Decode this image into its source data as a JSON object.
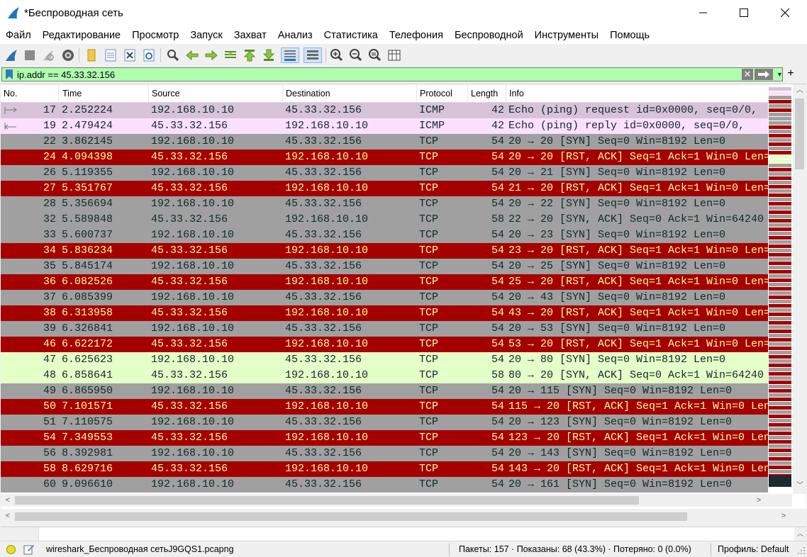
{
  "window": {
    "title": "*Беспроводная сеть"
  },
  "menu": [
    "Файл",
    "Редактирование",
    "Просмотр",
    "Запуск",
    "Захват",
    "Анализ",
    "Статистика",
    "Телефония",
    "Беспроводной",
    "Инструменты",
    "Помощь"
  ],
  "toolbar": {
    "icons": [
      "shark-fin-start-icon",
      "stop-capture-icon",
      "restart-capture-icon",
      "capture-options-icon",
      "open-file-icon",
      "save-file-icon",
      "close-file-icon",
      "reload-file-icon",
      "find-packet-icon",
      "go-back-icon",
      "go-forward-icon",
      "go-to-packet-icon",
      "go-first-icon",
      "go-last-icon",
      "autoscroll-icon",
      "colorize-icon",
      "zoom-in-icon",
      "zoom-out-icon",
      "zoom-normal-icon",
      "resize-columns-icon"
    ]
  },
  "filter": {
    "value": "ip.addr == 45.33.32.156",
    "background": "#afffaf"
  },
  "columns": [
    "No.",
    "Time",
    "Source",
    "Destination",
    "Protocol",
    "Length",
    "Info"
  ],
  "colors": {
    "icmp_request": "#d8c2da",
    "icmp_reply": "#fce0ff",
    "tcp_syn": "#a0a0a0",
    "tcp_rst": "#a40000",
    "tcp_rst_text": "#fffc9c",
    "tcp_http": "#e4ffc7"
  },
  "packets": [
    {
      "no": "17",
      "time": "2.252224",
      "src": "192.168.10.10",
      "dst": "45.33.32.156",
      "proto": "ICMP",
      "len": "42",
      "info": "Echo (ping) request  id=0x0000, seq=0/0,",
      "style": "icmp_request"
    },
    {
      "no": "19",
      "time": "2.479424",
      "src": "45.33.32.156",
      "dst": "192.168.10.10",
      "proto": "ICMP",
      "len": "42",
      "info": "Echo (ping) reply    id=0x0000, seq=0/0,",
      "style": "icmp_reply"
    },
    {
      "no": "22",
      "time": "3.862145",
      "src": "192.168.10.10",
      "dst": "45.33.32.156",
      "proto": "TCP",
      "len": "54",
      "info": "20 → 20 [SYN] Seq=0 Win=8192 Len=0",
      "style": "tcp_syn"
    },
    {
      "no": "24",
      "time": "4.094398",
      "src": "45.33.32.156",
      "dst": "192.168.10.10",
      "proto": "TCP",
      "len": "54",
      "info": "20 → 20 [RST, ACK] Seq=1 Ack=1 Win=0 Len=",
      "style": "tcp_rst"
    },
    {
      "no": "26",
      "time": "5.119355",
      "src": "192.168.10.10",
      "dst": "45.33.32.156",
      "proto": "TCP",
      "len": "54",
      "info": "20 → 21 [SYN] Seq=0 Win=8192 Len=0",
      "style": "tcp_syn"
    },
    {
      "no": "27",
      "time": "5.351767",
      "src": "45.33.32.156",
      "dst": "192.168.10.10",
      "proto": "TCP",
      "len": "54",
      "info": "21 → 20 [RST, ACK] Seq=1 Ack=1 Win=0 Len=",
      "style": "tcp_rst"
    },
    {
      "no": "28",
      "time": "5.356694",
      "src": "192.168.10.10",
      "dst": "45.33.32.156",
      "proto": "TCP",
      "len": "54",
      "info": "20 → 22 [SYN] Seq=0 Win=8192 Len=0",
      "style": "tcp_syn"
    },
    {
      "no": "32",
      "time": "5.589848",
      "src": "45.33.32.156",
      "dst": "192.168.10.10",
      "proto": "TCP",
      "len": "58",
      "info": "22 → 20 [SYN, ACK] Seq=0 Ack=1 Win=64240",
      "style": "tcp_syn"
    },
    {
      "no": "33",
      "time": "5.600737",
      "src": "192.168.10.10",
      "dst": "45.33.32.156",
      "proto": "TCP",
      "len": "54",
      "info": "20 → 23 [SYN] Seq=0 Win=8192 Len=0",
      "style": "tcp_syn"
    },
    {
      "no": "34",
      "time": "5.836234",
      "src": "45.33.32.156",
      "dst": "192.168.10.10",
      "proto": "TCP",
      "len": "54",
      "info": "23 → 20 [RST, ACK] Seq=1 Ack=1 Win=0 Len=",
      "style": "tcp_rst"
    },
    {
      "no": "35",
      "time": "5.845174",
      "src": "192.168.10.10",
      "dst": "45.33.32.156",
      "proto": "TCP",
      "len": "54",
      "info": "20 → 25 [SYN] Seq=0 Win=8192 Len=0",
      "style": "tcp_syn"
    },
    {
      "no": "36",
      "time": "6.082526",
      "src": "45.33.32.156",
      "dst": "192.168.10.10",
      "proto": "TCP",
      "len": "54",
      "info": "25 → 20 [RST, ACK] Seq=1 Ack=1 Win=0 Len=",
      "style": "tcp_rst"
    },
    {
      "no": "37",
      "time": "6.085399",
      "src": "192.168.10.10",
      "dst": "45.33.32.156",
      "proto": "TCP",
      "len": "54",
      "info": "20 → 43 [SYN] Seq=0 Win=8192 Len=0",
      "style": "tcp_syn"
    },
    {
      "no": "38",
      "time": "6.313958",
      "src": "45.33.32.156",
      "dst": "192.168.10.10",
      "proto": "TCP",
      "len": "54",
      "info": "43 → 20 [RST, ACK] Seq=1 Ack=1 Win=0 Len=",
      "style": "tcp_rst"
    },
    {
      "no": "39",
      "time": "6.326841",
      "src": "192.168.10.10",
      "dst": "45.33.32.156",
      "proto": "TCP",
      "len": "54",
      "info": "20 → 53 [SYN] Seq=0 Win=8192 Len=0",
      "style": "tcp_syn"
    },
    {
      "no": "46",
      "time": "6.622172",
      "src": "45.33.32.156",
      "dst": "192.168.10.10",
      "proto": "TCP",
      "len": "54",
      "info": "53 → 20 [RST, ACK] Seq=1 Ack=1 Win=0 Len=",
      "style": "tcp_rst"
    },
    {
      "no": "47",
      "time": "6.625623",
      "src": "192.168.10.10",
      "dst": "45.33.32.156",
      "proto": "TCP",
      "len": "54",
      "info": "20 → 80 [SYN] Seq=0 Win=8192 Len=0",
      "style": "tcp_http"
    },
    {
      "no": "48",
      "time": "6.858641",
      "src": "45.33.32.156",
      "dst": "192.168.10.10",
      "proto": "TCP",
      "len": "58",
      "info": "80 → 20 [SYN, ACK] Seq=0 Ack=1 Win=64240",
      "style": "tcp_http"
    },
    {
      "no": "49",
      "time": "6.865950",
      "src": "192.168.10.10",
      "dst": "45.33.32.156",
      "proto": "TCP",
      "len": "54",
      "info": "20 → 115 [SYN] Seq=0 Win=8192 Len=0",
      "style": "tcp_syn"
    },
    {
      "no": "50",
      "time": "7.101571",
      "src": "45.33.32.156",
      "dst": "192.168.10.10",
      "proto": "TCP",
      "len": "54",
      "info": "115 → 20 [RST, ACK] Seq=1 Ack=1 Win=0 Len",
      "style": "tcp_rst"
    },
    {
      "no": "51",
      "time": "7.110575",
      "src": "192.168.10.10",
      "dst": "45.33.32.156",
      "proto": "TCP",
      "len": "54",
      "info": "20 → 123 [SYN] Seq=0 Win=8192 Len=0",
      "style": "tcp_syn"
    },
    {
      "no": "54",
      "time": "7.349553",
      "src": "45.33.32.156",
      "dst": "192.168.10.10",
      "proto": "TCP",
      "len": "54",
      "info": "123 → 20 [RST, ACK] Seq=1 Ack=1 Win=0 Len",
      "style": "tcp_rst"
    },
    {
      "no": "56",
      "time": "8.392981",
      "src": "192.168.10.10",
      "dst": "45.33.32.156",
      "proto": "TCP",
      "len": "54",
      "info": "20 → 143 [SYN] Seq=0 Win=8192 Len=0",
      "style": "tcp_syn"
    },
    {
      "no": "58",
      "time": "8.629716",
      "src": "45.33.32.156",
      "dst": "192.168.10.10",
      "proto": "TCP",
      "len": "54",
      "info": "143 → 20 [RST, ACK] Seq=1 Ack=1 Win=0 Len",
      "style": "tcp_rst"
    },
    {
      "no": "60",
      "time": "9.096610",
      "src": "192.168.10.10",
      "dst": "45.33.32.156",
      "proto": "TCP",
      "len": "54",
      "info": "20 → 161 [SYN] Seq=0 Win=8192 Len=0",
      "style": "tcp_syn"
    }
  ],
  "status": {
    "file": "wireshark_Беспроводная сетьJ9GQS1.pcapng",
    "stats": "Пакеты: 157 · Показаны: 68 (43.3%) · Потеряно: 0 (0.0%)",
    "profile": "Профиль: Default"
  }
}
